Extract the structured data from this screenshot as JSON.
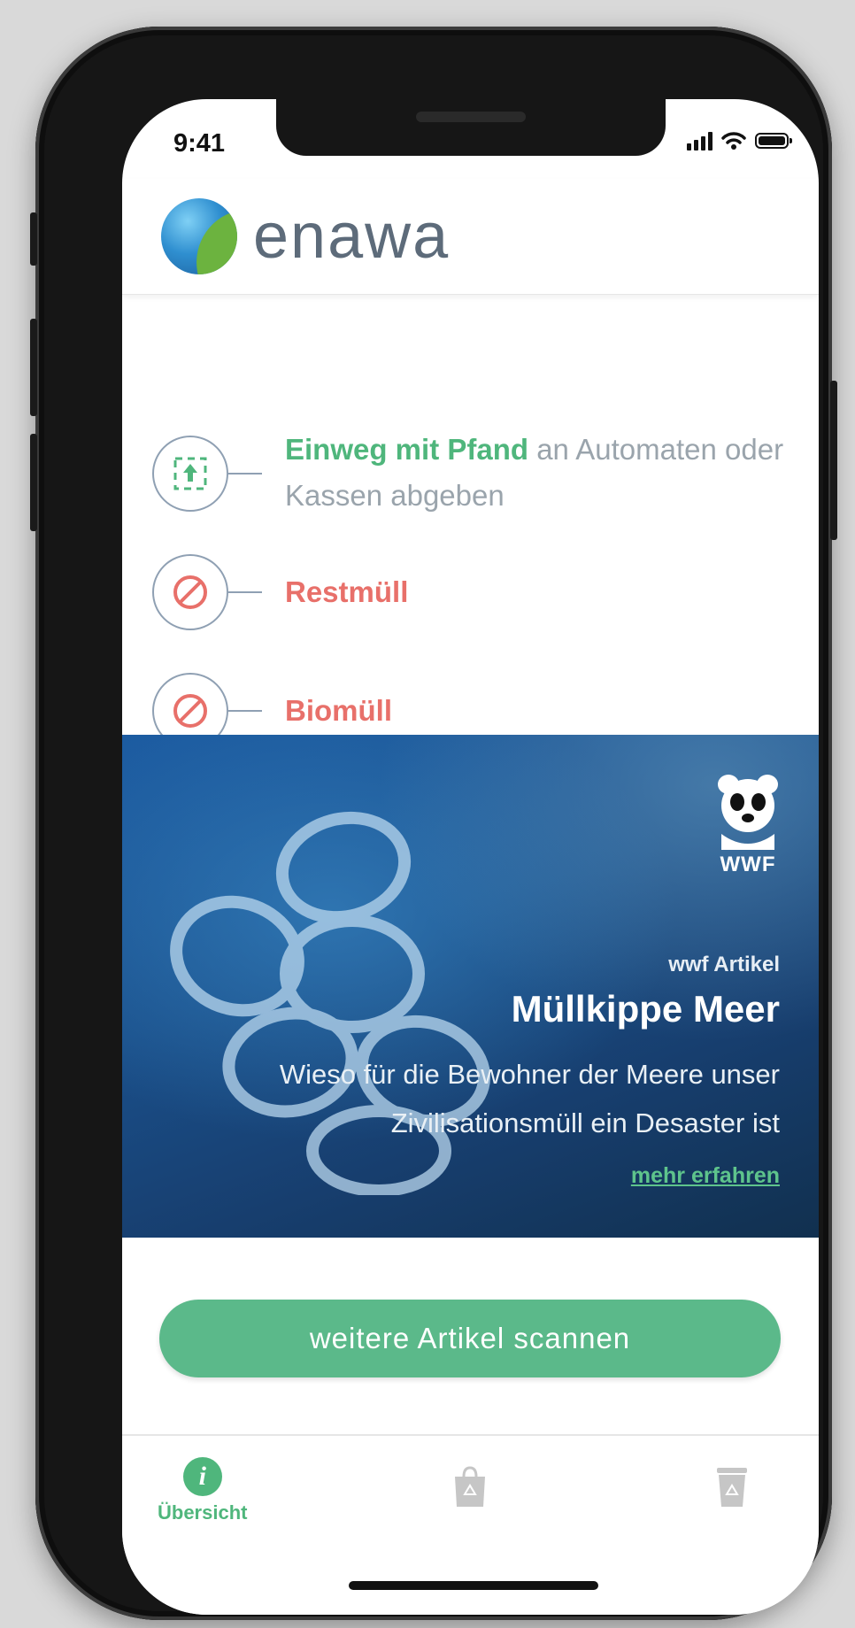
{
  "status_bar": {
    "time": "9:41"
  },
  "app": {
    "logo_text": "enawa"
  },
  "rules": [
    {
      "highlight": "Einweg mit Pfand",
      "text": " an Automaten oder Kassen abgeben",
      "icon": "bottle-return-icon",
      "style": "green"
    },
    {
      "highlight": "Restmüll",
      "text": "",
      "icon": "prohibited-icon",
      "style": "red"
    },
    {
      "highlight": "Biomüll",
      "text": "",
      "icon": "prohibited-icon",
      "style": "red"
    }
  ],
  "teaser": {
    "brand": "WWF",
    "kicker": "wwf Artikel",
    "title": "Müllkippe Meer",
    "text": "Wieso für die Bewohner der Meere unser Zivilisationsmüll ein Desaster ist",
    "link": "mehr erfahren"
  },
  "primary_button": {
    "label": "weitere Artikel scannen"
  },
  "tabbar": {
    "items": [
      {
        "label": "Übersicht",
        "icon": "info-icon",
        "active": true
      },
      {
        "label": "",
        "icon": "recycling-bag-icon",
        "active": false
      },
      {
        "label": "",
        "icon": "recycling-bin-icon",
        "active": false
      }
    ]
  },
  "colors": {
    "accent": "#4fb67c",
    "warning": "#e8706a",
    "text_muted": "#9aa4ac"
  }
}
